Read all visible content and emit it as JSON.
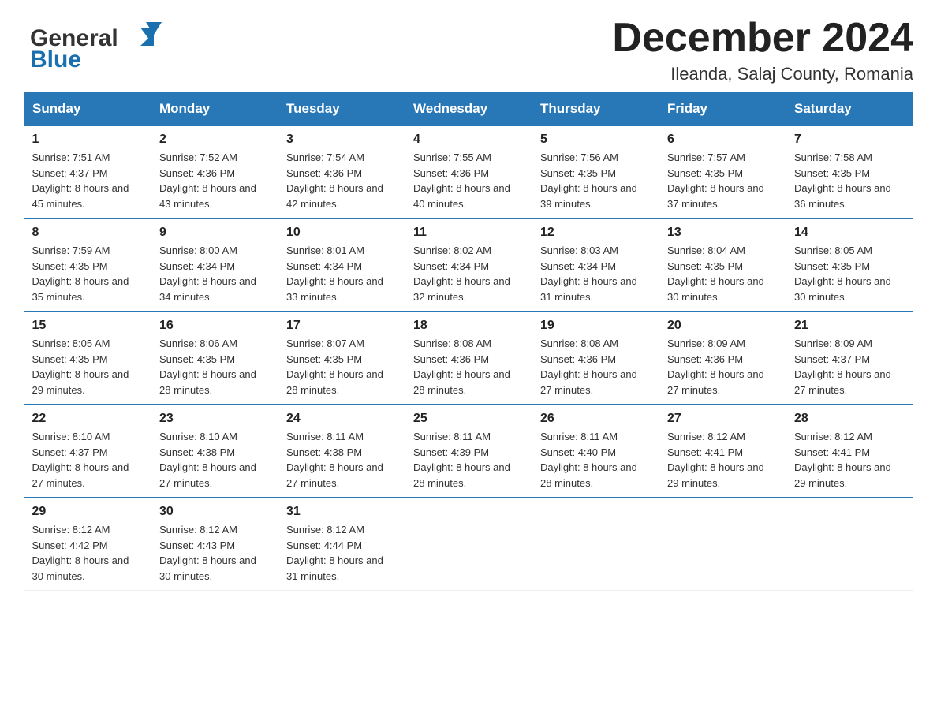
{
  "header": {
    "logo_line1": "General",
    "logo_line2": "Blue",
    "month_title": "December 2024",
    "location": "Ileanda, Salaj County, Romania"
  },
  "days_of_week": [
    "Sunday",
    "Monday",
    "Tuesday",
    "Wednesday",
    "Thursday",
    "Friday",
    "Saturday"
  ],
  "weeks": [
    [
      {
        "day": "1",
        "sunrise": "7:51 AM",
        "sunset": "4:37 PM",
        "daylight": "8 hours and 45 minutes."
      },
      {
        "day": "2",
        "sunrise": "7:52 AM",
        "sunset": "4:36 PM",
        "daylight": "8 hours and 43 minutes."
      },
      {
        "day": "3",
        "sunrise": "7:54 AM",
        "sunset": "4:36 PM",
        "daylight": "8 hours and 42 minutes."
      },
      {
        "day": "4",
        "sunrise": "7:55 AM",
        "sunset": "4:36 PM",
        "daylight": "8 hours and 40 minutes."
      },
      {
        "day": "5",
        "sunrise": "7:56 AM",
        "sunset": "4:35 PM",
        "daylight": "8 hours and 39 minutes."
      },
      {
        "day": "6",
        "sunrise": "7:57 AM",
        "sunset": "4:35 PM",
        "daylight": "8 hours and 37 minutes."
      },
      {
        "day": "7",
        "sunrise": "7:58 AM",
        "sunset": "4:35 PM",
        "daylight": "8 hours and 36 minutes."
      }
    ],
    [
      {
        "day": "8",
        "sunrise": "7:59 AM",
        "sunset": "4:35 PM",
        "daylight": "8 hours and 35 minutes."
      },
      {
        "day": "9",
        "sunrise": "8:00 AM",
        "sunset": "4:34 PM",
        "daylight": "8 hours and 34 minutes."
      },
      {
        "day": "10",
        "sunrise": "8:01 AM",
        "sunset": "4:34 PM",
        "daylight": "8 hours and 33 minutes."
      },
      {
        "day": "11",
        "sunrise": "8:02 AM",
        "sunset": "4:34 PM",
        "daylight": "8 hours and 32 minutes."
      },
      {
        "day": "12",
        "sunrise": "8:03 AM",
        "sunset": "4:34 PM",
        "daylight": "8 hours and 31 minutes."
      },
      {
        "day": "13",
        "sunrise": "8:04 AM",
        "sunset": "4:35 PM",
        "daylight": "8 hours and 30 minutes."
      },
      {
        "day": "14",
        "sunrise": "8:05 AM",
        "sunset": "4:35 PM",
        "daylight": "8 hours and 30 minutes."
      }
    ],
    [
      {
        "day": "15",
        "sunrise": "8:05 AM",
        "sunset": "4:35 PM",
        "daylight": "8 hours and 29 minutes."
      },
      {
        "day": "16",
        "sunrise": "8:06 AM",
        "sunset": "4:35 PM",
        "daylight": "8 hours and 28 minutes."
      },
      {
        "day": "17",
        "sunrise": "8:07 AM",
        "sunset": "4:35 PM",
        "daylight": "8 hours and 28 minutes."
      },
      {
        "day": "18",
        "sunrise": "8:08 AM",
        "sunset": "4:36 PM",
        "daylight": "8 hours and 28 minutes."
      },
      {
        "day": "19",
        "sunrise": "8:08 AM",
        "sunset": "4:36 PM",
        "daylight": "8 hours and 27 minutes."
      },
      {
        "day": "20",
        "sunrise": "8:09 AM",
        "sunset": "4:36 PM",
        "daylight": "8 hours and 27 minutes."
      },
      {
        "day": "21",
        "sunrise": "8:09 AM",
        "sunset": "4:37 PM",
        "daylight": "8 hours and 27 minutes."
      }
    ],
    [
      {
        "day": "22",
        "sunrise": "8:10 AM",
        "sunset": "4:37 PM",
        "daylight": "8 hours and 27 minutes."
      },
      {
        "day": "23",
        "sunrise": "8:10 AM",
        "sunset": "4:38 PM",
        "daylight": "8 hours and 27 minutes."
      },
      {
        "day": "24",
        "sunrise": "8:11 AM",
        "sunset": "4:38 PM",
        "daylight": "8 hours and 27 minutes."
      },
      {
        "day": "25",
        "sunrise": "8:11 AM",
        "sunset": "4:39 PM",
        "daylight": "8 hours and 28 minutes."
      },
      {
        "day": "26",
        "sunrise": "8:11 AM",
        "sunset": "4:40 PM",
        "daylight": "8 hours and 28 minutes."
      },
      {
        "day": "27",
        "sunrise": "8:12 AM",
        "sunset": "4:41 PM",
        "daylight": "8 hours and 29 minutes."
      },
      {
        "day": "28",
        "sunrise": "8:12 AM",
        "sunset": "4:41 PM",
        "daylight": "8 hours and 29 minutes."
      }
    ],
    [
      {
        "day": "29",
        "sunrise": "8:12 AM",
        "sunset": "4:42 PM",
        "daylight": "8 hours and 30 minutes."
      },
      {
        "day": "30",
        "sunrise": "8:12 AM",
        "sunset": "4:43 PM",
        "daylight": "8 hours and 30 minutes."
      },
      {
        "day": "31",
        "sunrise": "8:12 AM",
        "sunset": "4:44 PM",
        "daylight": "8 hours and 31 minutes."
      },
      null,
      null,
      null,
      null
    ]
  ],
  "labels": {
    "sunrise": "Sunrise: ",
    "sunset": "Sunset: ",
    "daylight": "Daylight: "
  }
}
